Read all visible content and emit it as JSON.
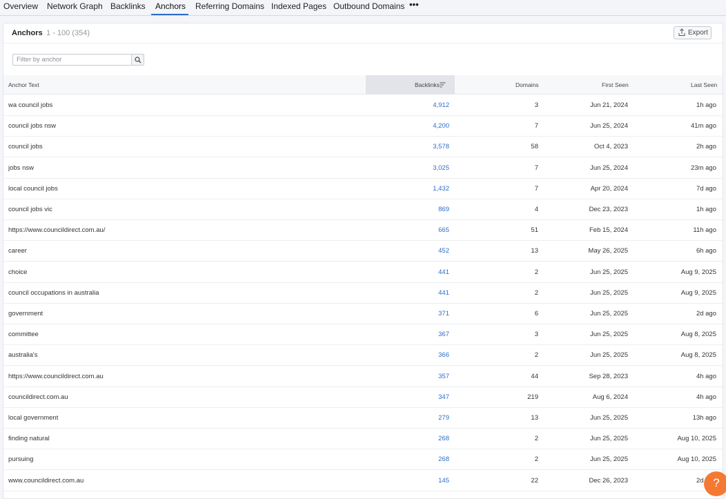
{
  "tabs": [
    "Overview",
    "Network Graph",
    "Backlinks",
    "Anchors",
    "Referring Domains",
    "Indexed Pages",
    "Outbound Domains"
  ],
  "more_label": "•••",
  "active_tab": "Anchors",
  "card": {
    "title": "Anchors",
    "subtitle": "1 - 100 (354)",
    "export_label": "Export"
  },
  "filter": {
    "placeholder": "Filter by anchor",
    "value": ""
  },
  "table": {
    "headers": {
      "anchor": "Anchor Text",
      "backlinks": "Backlinks",
      "domains": "Domains",
      "first_seen": "First Seen",
      "last_seen": "Last Seen"
    },
    "sorted_column": "backlinks",
    "rows": [
      {
        "anchor": "wa council jobs",
        "backlinks": "4,912",
        "domains": "3",
        "first_seen": "Jun 21, 2024",
        "last_seen": "1h ago"
      },
      {
        "anchor": "council jobs nsw",
        "backlinks": "4,200",
        "domains": "7",
        "first_seen": "Jun 25, 2024",
        "last_seen": "41m ago"
      },
      {
        "anchor": "council jobs",
        "backlinks": "3,578",
        "domains": "58",
        "first_seen": "Oct 4, 2023",
        "last_seen": "2h ago"
      },
      {
        "anchor": "jobs nsw",
        "backlinks": "3,025",
        "domains": "7",
        "first_seen": "Jun 25, 2024",
        "last_seen": "23m ago"
      },
      {
        "anchor": "local council jobs",
        "backlinks": "1,432",
        "domains": "7",
        "first_seen": "Apr 20, 2024",
        "last_seen": "7d ago"
      },
      {
        "anchor": "council jobs vic",
        "backlinks": "869",
        "domains": "4",
        "first_seen": "Dec 23, 2023",
        "last_seen": "1h ago"
      },
      {
        "anchor": "https://www.councildirect.com.au/",
        "backlinks": "665",
        "domains": "51",
        "first_seen": "Feb 15, 2024",
        "last_seen": "11h ago"
      },
      {
        "anchor": "career",
        "backlinks": "452",
        "domains": "13",
        "first_seen": "May 26, 2025",
        "last_seen": "6h ago"
      },
      {
        "anchor": "choice",
        "backlinks": "441",
        "domains": "2",
        "first_seen": "Jun 25, 2025",
        "last_seen": "Aug 9, 2025"
      },
      {
        "anchor": "council occupations in australia",
        "backlinks": "441",
        "domains": "2",
        "first_seen": "Jun 25, 2025",
        "last_seen": "Aug 9, 2025"
      },
      {
        "anchor": "government",
        "backlinks": "371",
        "domains": "6",
        "first_seen": "Jun 25, 2025",
        "last_seen": "2d ago"
      },
      {
        "anchor": "committee",
        "backlinks": "367",
        "domains": "3",
        "first_seen": "Jun 25, 2025",
        "last_seen": "Aug 8, 2025"
      },
      {
        "anchor": "australia's",
        "backlinks": "366",
        "domains": "2",
        "first_seen": "Jun 25, 2025",
        "last_seen": "Aug 8, 2025"
      },
      {
        "anchor": "https://www.councildirect.com.au",
        "backlinks": "357",
        "domains": "44",
        "first_seen": "Sep 28, 2023",
        "last_seen": "4h ago"
      },
      {
        "anchor": "councildirect.com.au",
        "backlinks": "347",
        "domains": "219",
        "first_seen": "Aug 6, 2024",
        "last_seen": "4h ago"
      },
      {
        "anchor": "local government",
        "backlinks": "279",
        "domains": "13",
        "first_seen": "Jun 25, 2025",
        "last_seen": "13h ago"
      },
      {
        "anchor": "finding natural",
        "backlinks": "268",
        "domains": "2",
        "first_seen": "Jun 25, 2025",
        "last_seen": "Aug 10, 2025"
      },
      {
        "anchor": "pursuing",
        "backlinks": "268",
        "domains": "2",
        "first_seen": "Jun 25, 2025",
        "last_seen": "Aug 10, 2025"
      },
      {
        "anchor": "www.councildirect.com.au",
        "backlinks": "145",
        "domains": "22",
        "first_seen": "Dec 26, 2023",
        "last_seen": "2d ago"
      }
    ]
  },
  "help_label": "?",
  "colors": {
    "accent": "#2c6ecb",
    "help": "#f47a33"
  },
  "icons": {
    "export": "upload-icon",
    "search": "search-icon",
    "sort": "sort-icon",
    "more": "more-horizontal-icon"
  }
}
